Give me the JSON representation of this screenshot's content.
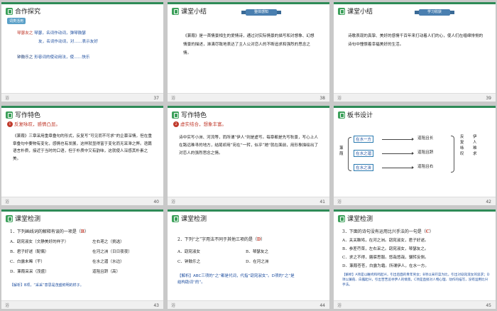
{
  "slides": [
    {
      "number": "37",
      "title": "合作探究",
      "badge": "词类活用",
      "lines": [
        {
          "key": "琴瑟友之",
          "text": "琴瑟，名词作动词，弹琴鼓瑟"
        },
        {
          "key": "",
          "text": "友，名词作动词，对……表示友好"
        },
        {
          "key": "钟鼓乐之",
          "text": "形容词的使动用法，使……快乐"
        }
      ]
    },
    {
      "number": "38",
      "title": "课堂小结",
      "ribbon": "整体感知",
      "body": "《蒹葭》是一首情景相生的爱情诗，通过对实际情景的描写和对想象、幻想情景的描述，淋漓尽致地表达了主人公对恋人的不断追求和强烈的思念之情。"
    },
    {
      "number": "39",
      "title": "课堂小结",
      "ribbon": "学习收获",
      "body": "诗歌表现的真挚、美好的感情千百年来打动着人们的心，使人们在缠绵悱恻的诗句中憧憬着幸福美好的生活。"
    },
    {
      "number": "40",
      "title": "写作特色",
      "point_no": "1",
      "point": "反复咏叹，感情凸显。",
      "body": "《蒹葭》三章采用重章叠句的形式，反复写“可见而不可求”的企慕深情，但在重章叠句中要物有变化，感情也有发展，这样就显得富于变化而无呆滞之弊。语篇语言朴质，接近于当时的口语，但于朴质中又有韵味，这就使人深感其朴素之美。"
    },
    {
      "number": "41",
      "title": "写作特色",
      "point_no": "2",
      "point": "虚实结合，想象丰富。",
      "body": "诗中实写小洲、河流等，而所谓“伊人”则是虚写。每章都是先写秋景，写心上人在路远难寻的地方，结尾却用“宛在”一转，似乎“她”就在面前，用形象描绘出了对恋人的强烈思念之情。"
    },
    {
      "number": "42",
      "title": "板书设计",
      "left": "蒹葭",
      "rows": [
        {
          "place": "在水一方",
          "path": "道阻且长"
        },
        {
          "place": "在水之湄",
          "path": "道阻且跻"
        },
        {
          "place": "在水之涘",
          "path": "道阻且右"
        }
      ],
      "right_cols": [
        "反复咏叹",
        "伊人难求"
      ]
    },
    {
      "number": "43",
      "title": "课堂检测",
      "question": "1．下列画线词的解释有误的一项是（",
      "answer": "B",
      "question_end": "）",
      "options": [
        {
          "l": "A．窈窕淑女（文静美好的样子）",
          "r": "左右芼之（挑选）"
        },
        {
          "l": "B．君子好逑（配偶）",
          "r": "在河之洲（日日夜夜）"
        },
        {
          "l": "C．白露未晞（干）",
          "r": "在水之湄（水边）"
        },
        {
          "l": "D．蒹葭采采（茂盛）",
          "r": "道阻且跻（高）"
        }
      ],
      "analysis": "【解析】B项，“采采”意思是茂盛鲜明的样子。"
    },
    {
      "number": "44",
      "title": "课堂检测",
      "question": "2．下列“之”字用法不同于其他三项的是（",
      "answer": "D",
      "question_end": "）",
      "options": [
        {
          "l": "A．窈窕淑女",
          "r": "B．琴瑟友之"
        },
        {
          "l": "C．钟鼓乐之",
          "r": "D．在河之洲"
        }
      ],
      "analysis": "【解析】ABC三项的“之”都是代词，代指“窈窕淑女”。D项的“之”是结构助词“的”。"
    },
    {
      "number": "45",
      "title": "课堂检测",
      "question": "3．下面的诗句没有运用比兴手法的一句是（",
      "answer": "C",
      "question_end": "）",
      "options": [
        {
          "l": "A．关关雎鸠，在河之洲。窈窕淑女，君子好逑。"
        },
        {
          "l": "B．参差荇菜，左右采之。窈窕淑女，琴瑟友之。"
        },
        {
          "l": "C．求之不得，寤寐思服。悠哉悠哉，辗转反侧。"
        },
        {
          "l": "D．蒹葭苍苍，白露为霜。所谓伊人，在水一方。"
        }
      ],
      "analysis": "【解析】A项是以雎鸠和鸣起兴，引出后面的青年男女；B项以采荇菜为比，引出对窈窕淑女的追求；D项以蒹葭、白露起兴，引出苦苦追寻伊人的情景。C项是直接对人物心理、动作的描写，没有运用比兴手法。"
    }
  ],
  "footer_glyph": "浴",
  "colors": {
    "accent": "#2e8b57",
    "red": "#c0392b",
    "blue": "#1f4fa0",
    "background": "#c9c9c9"
  }
}
